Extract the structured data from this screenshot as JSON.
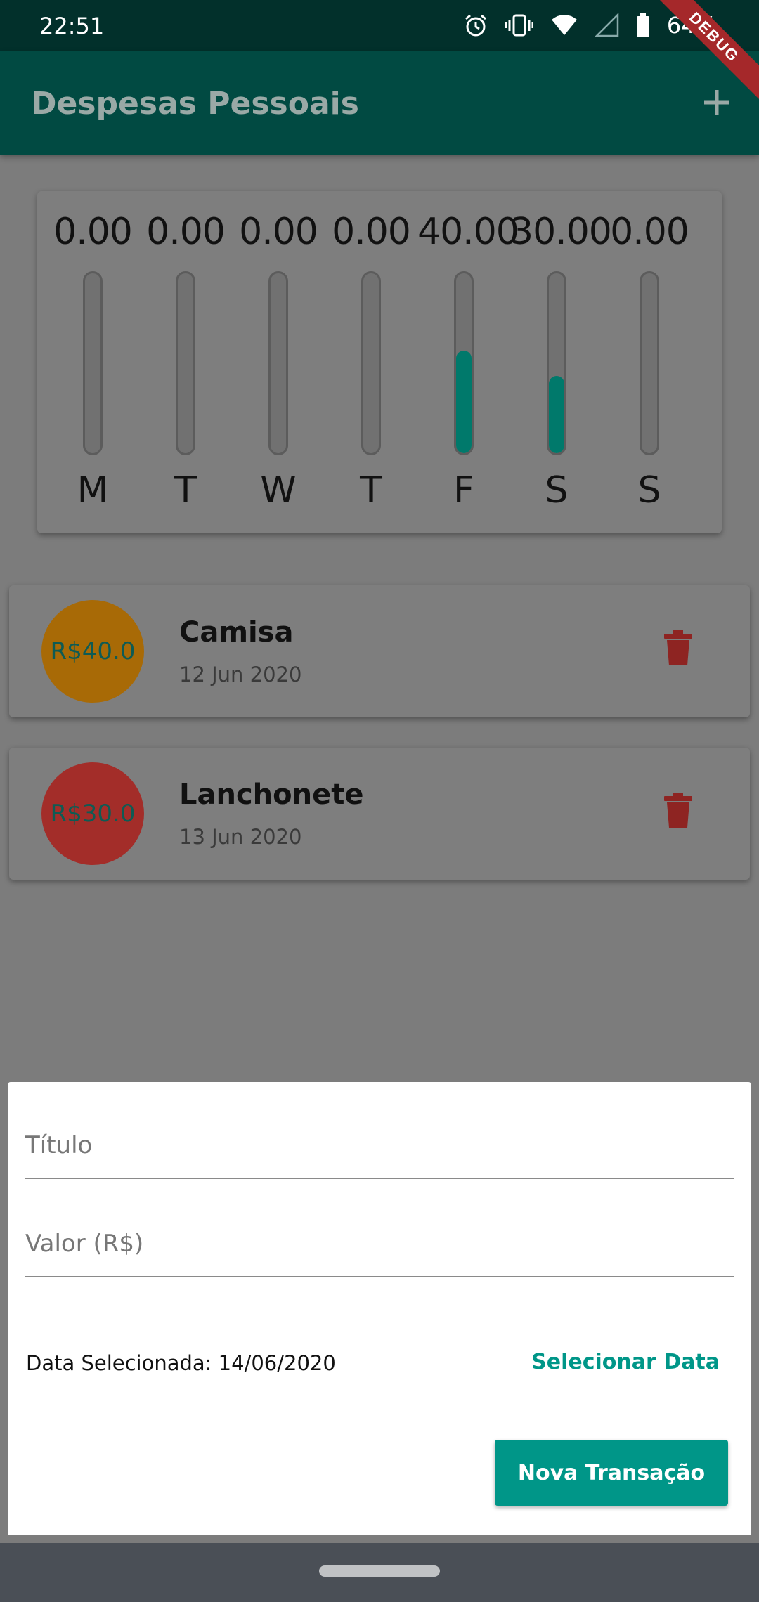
{
  "status": {
    "time": "22:51",
    "battery": "64%"
  },
  "debug_banner": "DEBUG",
  "app_bar": {
    "title": "Despesas Pessoais",
    "add_icon": "plus-icon"
  },
  "chart_data": {
    "type": "bar",
    "categories": [
      "M",
      "T",
      "W",
      "T",
      "F",
      "S",
      "S"
    ],
    "value_labels": [
      "0.00",
      "0.00",
      "0.00",
      "0.00",
      "40.00",
      "30.00",
      "0.00"
    ],
    "values": [
      0,
      0,
      0,
      0,
      40,
      30,
      0
    ],
    "fill_fractions": [
      0,
      0,
      0,
      0,
      0.5714,
      0.4286,
      0
    ],
    "bar_color": "#00796b"
  },
  "transactions": [
    {
      "amount": "R$40.0",
      "title": "Camisa",
      "date": "12 Jun 2020",
      "avatar_color": "#a86a06",
      "delete_icon": "trash-icon"
    },
    {
      "amount": "R$30.0",
      "title": "Lanchonete",
      "date": "13 Jun 2020",
      "avatar_color": "#a32d29",
      "delete_icon": "trash-icon"
    }
  ],
  "form": {
    "title_placeholder": "Título",
    "value_placeholder": "Valor (R$)",
    "selected_date": "Data Selecionada: 14/06/2020",
    "select_date_label": "Selecionar Data",
    "submit_label": "Nova Transação"
  },
  "colors": {
    "primary": "#009688",
    "app_bar": "#014a42",
    "danger": "#a32d29"
  }
}
